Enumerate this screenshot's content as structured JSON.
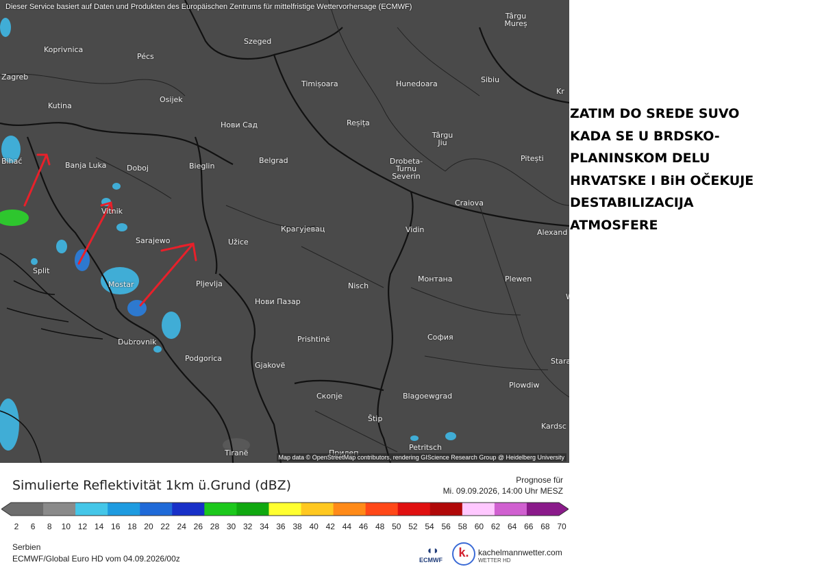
{
  "map": {
    "header_note": "Dieser Service basiert auf Daten und Produkten des Europäischen Zentrums für mittelfristige Wettervorhersage (ECMWF)",
    "attribution": "Map data © OpenStreetMap contributors, rendering GIScience Research Group @ Heidelberg University",
    "cities": [
      {
        "name": "Târgu Mureș"
      },
      {
        "name": "Koprivnica"
      },
      {
        "name": "Pécs"
      },
      {
        "name": "Szeged"
      },
      {
        "name": "Zagreb"
      },
      {
        "name": "Timișoara"
      },
      {
        "name": "Hunedoara"
      },
      {
        "name": "Sibiu"
      },
      {
        "name": "Kr"
      },
      {
        "name": "Kutina"
      },
      {
        "name": "Osijek"
      },
      {
        "name": "Нови Сад"
      },
      {
        "name": "Reșița"
      },
      {
        "name": "Târgu Jiu"
      },
      {
        "name": "Bihać"
      },
      {
        "name": "Banja Luka"
      },
      {
        "name": "Doboj"
      },
      {
        "name": "Bieglin"
      },
      {
        "name": "Belgrad"
      },
      {
        "name": "Drobeta-Turnu Severin"
      },
      {
        "name": "Pitești"
      },
      {
        "name": "Craiova"
      },
      {
        "name": "Vitnik"
      },
      {
        "name": "Крагујевац"
      },
      {
        "name": "Vidin"
      },
      {
        "name": "Alexand"
      },
      {
        "name": "Sarajewo"
      },
      {
        "name": "Užice"
      },
      {
        "name": "Split"
      },
      {
        "name": "Монтана"
      },
      {
        "name": "Plewen"
      },
      {
        "name": "Mostar"
      },
      {
        "name": "Pljevlja"
      },
      {
        "name": "Nisch"
      },
      {
        "name": "Нови Пазар"
      },
      {
        "name": "W Ta"
      },
      {
        "name": "Prishtinë"
      },
      {
        "name": "София"
      },
      {
        "name": "Dubrovnik"
      },
      {
        "name": "Podgorica"
      },
      {
        "name": "Gjakovë"
      },
      {
        "name": "Stara"
      },
      {
        "name": "Plowdiw"
      },
      {
        "name": "Скопје"
      },
      {
        "name": "Blagoewgrad"
      },
      {
        "name": "Štip"
      },
      {
        "name": "Kardsc"
      },
      {
        "name": "Tiranë"
      },
      {
        "name": "Прилеп"
      },
      {
        "name": "Petritsch"
      }
    ]
  },
  "annotation": {
    "lines": [
      "ZATIM DO SREDE SUVO",
      "KADA SE U BRDSKO-",
      "PLANINSKOM DELU",
      "HRVATSKE I BiH OČEKUJE",
      "DESTABILIZACIJA",
      "ATMOSFERE"
    ],
    "arrow_color": "#e8202a"
  },
  "legend": {
    "title": "Simulierte Reflektivität 1km ü.Grund (dBZ)",
    "prognose_label": "Prognose für",
    "prognose_date": "Mi. 09.09.2026, 14:00 Uhr MESZ",
    "ticks": [
      "2",
      "6",
      "8",
      "10",
      "12",
      "14",
      "16",
      "18",
      "20",
      "22",
      "24",
      "26",
      "28",
      "30",
      "32",
      "34",
      "36",
      "38",
      "40",
      "42",
      "44",
      "46",
      "48",
      "50",
      "52",
      "54",
      "56",
      "58",
      "60",
      "62",
      "64",
      "66",
      "68",
      "70"
    ],
    "colors": [
      "#6d6d6d",
      "#8a8a8a",
      "#44c6e8",
      "#1e9be0",
      "#1f6ad8",
      "#1830c8",
      "#1cc81c",
      "#10a810",
      "#ffff30",
      "#ffc820",
      "#ff8a18",
      "#ff4818",
      "#e01010",
      "#b00808",
      "#ffc8ff",
      "#d060d0",
      "#8a1a8a"
    ],
    "region": "Serbien",
    "model": "ECMWF/Global Euro HD vom  04.09.2026/00z"
  },
  "branding": {
    "ecmwf": "ECMWF",
    "kachelmann_site": "kachelmannwetter.com",
    "kachelmann_sub": "WETTER HD"
  }
}
